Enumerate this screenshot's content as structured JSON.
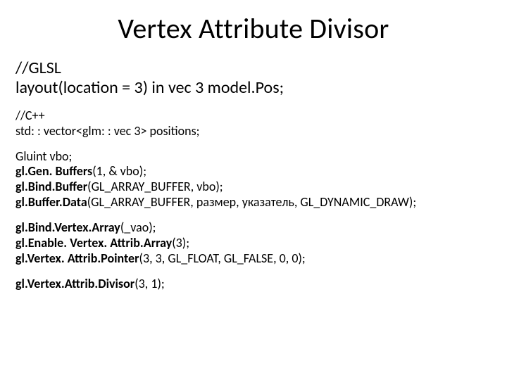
{
  "title": "Vertex Attribute Divisor",
  "glsl": {
    "l1": "//GLSL",
    "l2": "layout(location = 3) in vec 3 model.Pos;"
  },
  "cpp": {
    "l1": "//C++",
    "l2": "std: : vector<glm: : vec 3> positions;"
  },
  "vbo": {
    "l1": "Gluint vbo;",
    "l2a": "gl.Gen. Buffers",
    "l2b": "(1, & vbo);",
    "l3a": "gl.Bind.Buffer",
    "l3b": "(GL_ARRAY_BUFFER, vbo);",
    "l4a": "gl.Buffer.Data",
    "l4b": "(GL_ARRAY_BUFFER, размер, указатель, GL_DYNAMIC_DRAW);"
  },
  "vao": {
    "l1a": "gl.Bind.Vertex.Array",
    "l1b": "(_vao);",
    "l2a": "gl.Enable. Vertex. Attrib.Array",
    "l2b": "(3);",
    "l3a": "gl.Vertex. Attrib.Pointer",
    "l3b": "(3, 3, GL_FLOAT, GL_FALSE, 0, 0);"
  },
  "divisor": {
    "l1a": "gl.Vertex.Attrib.Divisor",
    "l1b": "(3, 1);"
  }
}
